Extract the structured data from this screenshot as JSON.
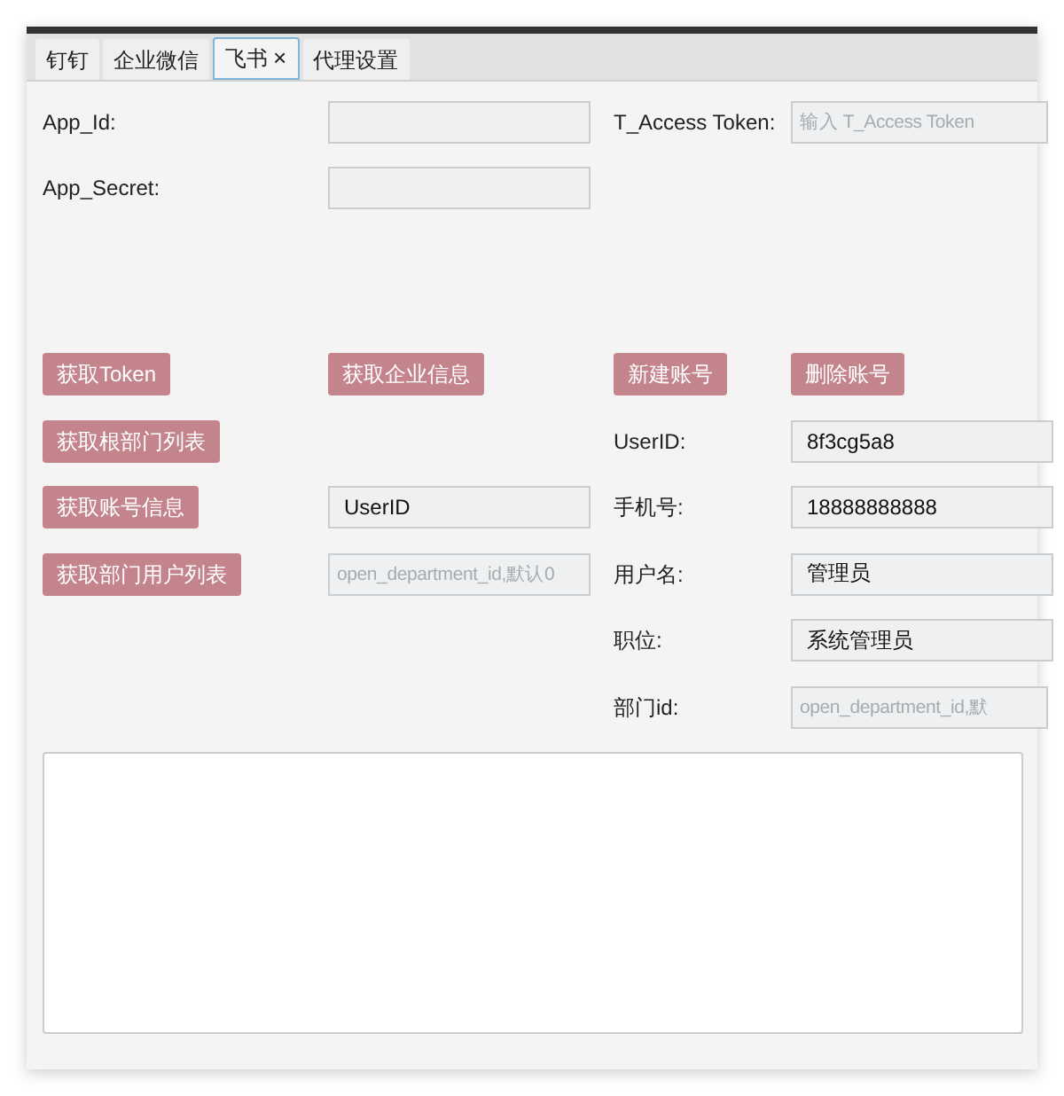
{
  "tabs": [
    {
      "label": "钉钉",
      "selected": false
    },
    {
      "label": "企业微信",
      "selected": false
    },
    {
      "label": "飞书",
      "selected": true,
      "close": "×"
    },
    {
      "label": "代理设置",
      "selected": false
    }
  ],
  "top_rows": [
    [
      {
        "kind": "label",
        "text": "App_Id:"
      },
      {
        "kind": "field"
      },
      {
        "kind": "label",
        "text": "T_Access Token:"
      },
      {
        "kind": "field",
        "placeholder": "输入 T_Access Token"
      }
    ],
    [
      {
        "kind": "label",
        "text": "App_Secret:"
      },
      {
        "kind": "field"
      },
      {
        "kind": "empty"
      },
      {
        "kind": "empty"
      }
    ]
  ],
  "rows": [
    [
      {
        "kind": "button",
        "text": "获取Token"
      },
      {
        "kind": "button",
        "text": "获取企业信息"
      },
      {
        "kind": "button",
        "text": "新建账号"
      },
      {
        "kind": "button",
        "text": "删除账号"
      }
    ],
    [
      {
        "kind": "button",
        "text": "获取根部门列表"
      },
      {
        "kind": "empty"
      },
      {
        "kind": "label",
        "text": "UserID:"
      },
      {
        "kind": "field",
        "value": "8f3cg5a8"
      }
    ],
    [
      {
        "kind": "button",
        "text": "获取账号信息"
      },
      {
        "kind": "field",
        "value": "UserID"
      },
      {
        "kind": "label",
        "text": "手机号:"
      },
      {
        "kind": "field",
        "value": "18888888888"
      }
    ],
    [
      {
        "kind": "button",
        "text": "获取部门用户列表"
      },
      {
        "kind": "field",
        "placeholder": "open_department_id,默认0"
      },
      {
        "kind": "label",
        "text": "用户名:"
      },
      {
        "kind": "field",
        "value": "管理员"
      }
    ],
    [
      {
        "kind": "empty"
      },
      {
        "kind": "empty"
      },
      {
        "kind": "label",
        "text": "职位:"
      },
      {
        "kind": "field",
        "value": "系统管理员"
      }
    ],
    [
      {
        "kind": "empty"
      },
      {
        "kind": "empty"
      },
      {
        "kind": "label",
        "text": "部门id:"
      },
      {
        "kind": "field",
        "placeholder": "open_department_id,默"
      }
    ]
  ]
}
